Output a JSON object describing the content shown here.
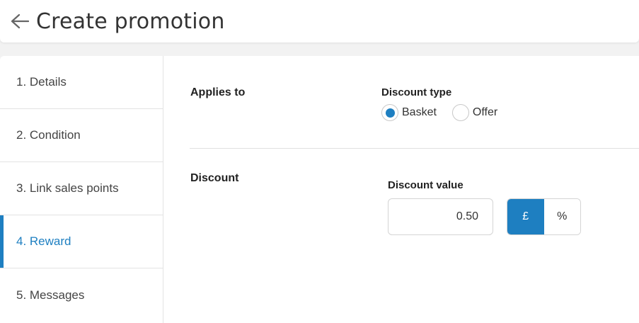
{
  "header": {
    "title": "Create promotion",
    "back_icon": "arrow-left-icon"
  },
  "sidebar": {
    "steps": [
      {
        "label": "1. Details",
        "active": false
      },
      {
        "label": "2. Condition",
        "active": false
      },
      {
        "label": "3. Link sales points",
        "active": false
      },
      {
        "label": "4. Reward",
        "active": true
      },
      {
        "label": "5. Messages",
        "active": false
      }
    ]
  },
  "applies_to": {
    "label": "Applies to",
    "discount_type": {
      "label": "Discount type",
      "options": [
        "Basket",
        "Offer"
      ],
      "selected": "Basket"
    }
  },
  "discount": {
    "label": "Discount",
    "value_label": "Discount value",
    "value": "0.50",
    "units": [
      "£",
      "%"
    ],
    "selected_unit": "£"
  },
  "colors": {
    "accent": "#1e7fc1",
    "background": "#f2f2f2"
  }
}
